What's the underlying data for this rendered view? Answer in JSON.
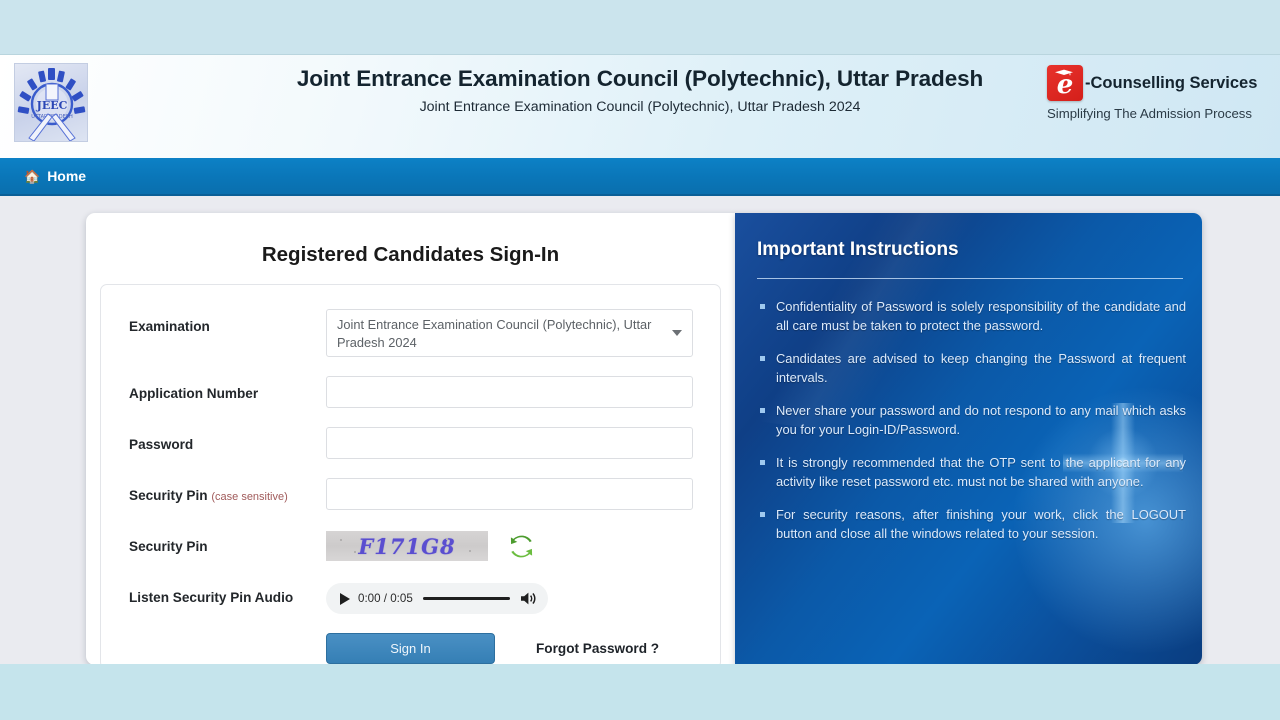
{
  "header": {
    "title": "Joint Entrance Examination Council (Polytechnic), Uttar Pradesh",
    "subtitle": "Joint Entrance Examination Council (Polytechnic), Uttar Pradesh 2024",
    "left_logo_alt": "JEEC",
    "brand": {
      "badge_letter": "e",
      "name": "-Counselling Services",
      "tagline": "Simplifying The Admission Process"
    }
  },
  "nav": {
    "items": [
      {
        "label": "Home",
        "icon": "home-icon"
      }
    ]
  },
  "signin": {
    "title": "Registered Candidates Sign-In",
    "fields": {
      "examination_label": "Examination",
      "examination_value": "Joint Entrance Examination Council (Polytechnic), Uttar Pradesh 2024",
      "application_number_label": "Application Number",
      "application_number_value": "",
      "application_number_placeholder": "",
      "password_label": "Password",
      "password_value": "",
      "password_placeholder": "",
      "security_pin_label": "Security Pin",
      "security_pin_note": "(case sensitive)",
      "security_pin_value": "",
      "security_pin_placeholder": "",
      "captcha_label": "Security Pin",
      "captcha_code": "F171G8",
      "audio_label": "Listen Security Pin Audio"
    },
    "audio": {
      "current_time": "0:00",
      "duration": "0:05",
      "time_display": "0:00 / 0:05"
    },
    "buttons": {
      "sign_in": "Sign In",
      "forgot_password": "Forgot Password ?"
    }
  },
  "instructions": {
    "title": "Important Instructions",
    "items": [
      "Confidentiality of Password is solely responsibility of the candidate and all care must be taken to protect the password.",
      "Candidates are advised to keep changing the Password at frequent intervals.",
      "Never share your password and do not respond to any mail which asks you for your Login-ID/Password.",
      "It is strongly recommended that the OTP sent to the applicant for any activity like reset password etc. must not be shared with anyone.",
      "For security reasons, after finishing your work, click the LOGOUT button and close all the windows related to your session."
    ]
  },
  "colors": {
    "nav_blue": "#0a76b8",
    "panel_blue": "#0b4f9c",
    "brand_red": "#d41f1a",
    "button_blue": "#357fb5",
    "captcha_text": "#5a4ed0",
    "page_bg": "#eaebf0",
    "band_blue": "#c5e4ec"
  }
}
